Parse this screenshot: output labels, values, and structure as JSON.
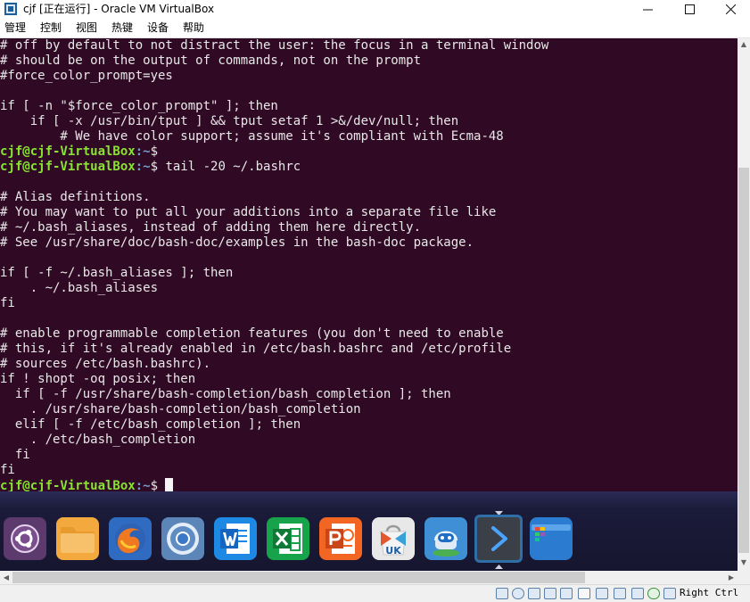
{
  "window": {
    "title": "cjf [正在运行] - Oracle VM VirtualBox",
    "icons": {
      "app": "virtualbox-icon",
      "minimize": "minimize-icon",
      "maximize": "maximize-icon",
      "close": "close-icon"
    }
  },
  "menu": {
    "items": [
      "管理",
      "控制",
      "视图",
      "热键",
      "设备",
      "帮助"
    ]
  },
  "terminal": {
    "prompt_user": "cjf@cjf-VirtualBox",
    "prompt_sep": ":",
    "prompt_path": "~",
    "lines": [
      {
        "text": "# off by default to not distract the user: the focus in a terminal window"
      },
      {
        "text": "# should be on the output of commands, not on the prompt"
      },
      {
        "text": "#force_color_prompt=yes"
      },
      {
        "text": ""
      },
      {
        "text": "if [ -n \"$force_color_prompt\" ]; then"
      },
      {
        "text": "    if [ -x /usr/bin/tput ] && tput setaf 1 >&/dev/null; then"
      },
      {
        "text": "        # We have color support; assume it's compliant with Ecma-48"
      },
      {
        "prompt": true,
        "cmd": ""
      },
      {
        "prompt": true,
        "cmd": "tail -20 ~/.bashrc"
      },
      {
        "text": ""
      },
      {
        "text": "# Alias definitions."
      },
      {
        "text": "# You may want to put all your additions into a separate file like"
      },
      {
        "text": "# ~/.bash_aliases, instead of adding them here directly."
      },
      {
        "text": "# See /usr/share/doc/bash-doc/examples in the bash-doc package."
      },
      {
        "text": ""
      },
      {
        "text": "if [ -f ~/.bash_aliases ]; then"
      },
      {
        "text": "    . ~/.bash_aliases"
      },
      {
        "text": "fi"
      },
      {
        "text": ""
      },
      {
        "text": "# enable programmable completion features (you don't need to enable"
      },
      {
        "text": "# this, if it's already enabled in /etc/bash.bashrc and /etc/profile"
      },
      {
        "text": "# sources /etc/bash.bashrc)."
      },
      {
        "text": "if ! shopt -oq posix; then"
      },
      {
        "text": "  if [ -f /usr/share/bash-completion/bash_completion ]; then"
      },
      {
        "text": "    . /usr/share/bash-completion/bash_completion"
      },
      {
        "text": "  elif [ -f /etc/bash_completion ]; then"
      },
      {
        "text": "    . /etc/bash_completion"
      },
      {
        "text": "  fi"
      },
      {
        "text": "fi"
      },
      {
        "prompt": true,
        "cmd": "",
        "cursor": true
      }
    ]
  },
  "dock": {
    "items": [
      {
        "name": "ubuntu-logo-icon",
        "bg": "#5d3a6e"
      },
      {
        "name": "files-folder-icon",
        "bg": "#f3a93d"
      },
      {
        "name": "firefox-icon",
        "bg": "#2f6bc0"
      },
      {
        "name": "chromium-browser-icon",
        "bg": "#5d86b8"
      },
      {
        "name": "wps-writer-icon",
        "bg": "#1e88e5"
      },
      {
        "name": "wps-spreadsheet-icon",
        "bg": "#16a34a"
      },
      {
        "name": "wps-presentation-icon",
        "bg": "#f26522"
      },
      {
        "name": "ubuntu-software-center-icon",
        "bg": "#e8e8e8"
      },
      {
        "name": "ubuntu-kylin-assistant-icon",
        "bg": "#3e8fd6"
      },
      {
        "name": "terminal-app-icon",
        "bg": "#3b4048"
      },
      {
        "name": "workspace-switcher-icon",
        "bg": "#2b7bd0"
      }
    ],
    "ui_labels": {
      "software_center_badge": "UK"
    }
  },
  "statusbar": {
    "icons": [
      "hard-disk-icon",
      "optical-drive-icon",
      "audio-icon",
      "network-icon",
      "usb-icon",
      "shared-folders-icon",
      "display-icon",
      "video-capture-icon",
      "cpu-virtualization-icon",
      "mouse-integration-icon",
      "keyboard-icon"
    ],
    "host_key": "Right Ctrl"
  },
  "colors": {
    "terminal_bg": "#300a24",
    "prompt_user": "#8ae234",
    "prompt_path": "#729fcf",
    "terminal_text": "#e8e8e8"
  }
}
